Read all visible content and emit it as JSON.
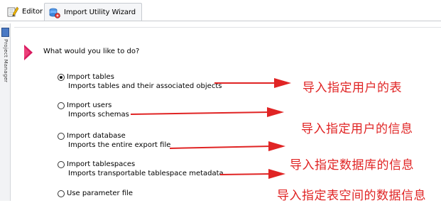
{
  "tabs": [
    {
      "label": "Editor",
      "icon": "pencil-editor-icon",
      "active": false
    },
    {
      "label": "Import Utility Wizard",
      "icon": "database-wizard-icon",
      "active": true
    }
  ],
  "side_panel": {
    "label": "Project Manager"
  },
  "wizard": {
    "question": "What would you like to do?",
    "options": [
      {
        "label": "Import tables",
        "description": "Imports tables and their associated objects",
        "selected": true
      },
      {
        "label": "Import users",
        "description": "Imports schemas",
        "selected": false
      },
      {
        "label": "Import database",
        "description": "Imports the entire export file",
        "selected": false
      },
      {
        "label": "Import tablespaces",
        "description": "Imports transportable tablespace metadata",
        "selected": false
      },
      {
        "label": "Use parameter file",
        "description": "",
        "selected": false
      }
    ]
  },
  "annotations": [
    "导入指定用户的表",
    "导入指定用户的信息",
    "导入指定数据库的信息",
    "导入指定表空间的数据信息"
  ],
  "colors": {
    "annotation": "#e02424",
    "pointer": "#d81b60",
    "accent_blue": "#4a79c4"
  }
}
